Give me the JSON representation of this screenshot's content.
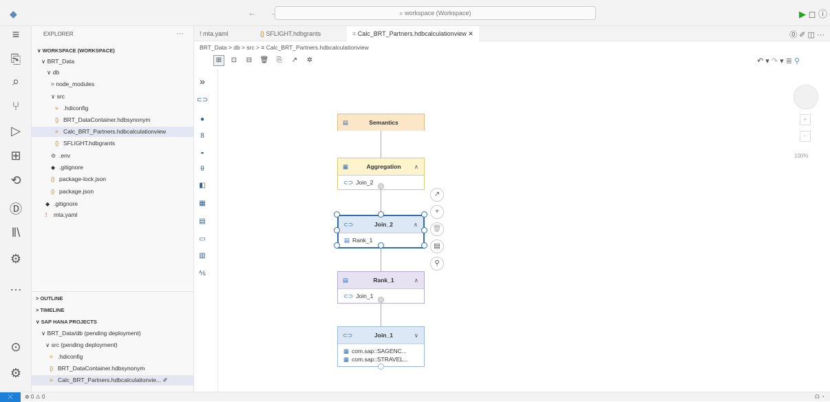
{
  "titlebar": {
    "search_placeholder": "workspace (Workspace)",
    "nav": "← →"
  },
  "explorer": {
    "header": "EXPLORER",
    "workspace": "WORKSPACE (WORKSPACE)",
    "items": [
      {
        "label": "BRT_Data",
        "chev": "∨"
      },
      {
        "label": "db",
        "chev": "∨"
      },
      {
        "label": "node_modules",
        "chev": ">"
      },
      {
        "label": "src",
        "chev": "∨"
      },
      {
        "label": ".hdiconfig",
        "icon": "≡"
      },
      {
        "label": "BRT_DataContainer.hdbsynonym",
        "icon": "{}"
      },
      {
        "label": "Calc_BRT_Partners.hdbcalculationview",
        "icon": "≡"
      },
      {
        "label": "SFLIGHT.hdbgrants",
        "icon": "{}"
      },
      {
        "label": ".env",
        "icon": "⚙"
      },
      {
        "label": ".gitignore",
        "icon": "◆"
      },
      {
        "label": "package-lock.json",
        "icon": "{}"
      },
      {
        "label": "package.json",
        "icon": "{}"
      },
      {
        "label": ".gitignore",
        "icon": "◆"
      },
      {
        "label": "mta.yaml",
        "icon": "!"
      }
    ],
    "outline": "OUTLINE",
    "timeline": "TIMELINE",
    "sap_hana": "SAP HANA PROJECTS",
    "hana_items": [
      {
        "label": "BRT_Data/db  (pending deployment)",
        "chev": "∨"
      },
      {
        "label": "src  (pending deployment)",
        "chev": "∨"
      },
      {
        "label": ".hdiconfig",
        "icon": "≡"
      },
      {
        "label": "BRT_DataContainer.hdbsynonym",
        "icon": "{}"
      },
      {
        "label": "Calc_BRT_Partners.hdbcalculationvie...",
        "icon": "≡"
      }
    ]
  },
  "tabs": [
    {
      "label": "mta.yaml",
      "icon": "!"
    },
    {
      "label": "SFLIGHT.hdbgrants",
      "icon": "{}"
    },
    {
      "label": "Calc_BRT_Partners.hdbcalculationview",
      "icon": "≡",
      "close": "✕"
    }
  ],
  "breadcrumb": "BRT_Data  >  db  >  src  >  ≡  Calc_BRT_Partners.hdbcalculationview",
  "zoom_level": "100%",
  "nodes": {
    "semantics": {
      "title": "Semantics"
    },
    "aggregation": {
      "title": "Aggregation",
      "input": "Join_2"
    },
    "join2": {
      "title": "Join_2",
      "input": "Rank_1"
    },
    "rank1": {
      "title": "Rank_1",
      "input": "Join_1"
    },
    "join1": {
      "title": "Join_1",
      "inputs": [
        "com.sap::SAGENC...",
        "com.sap::STRAVEL..."
      ]
    }
  },
  "status": {
    "problems": "⊗ 0 ⚠ 0"
  },
  "colors": {
    "semantics_header": "#fbe6c8",
    "aggregation_header": "#fdf3cc",
    "join_header": "#dde8f6",
    "rank_header": "#e6e2f2",
    "selected_border": "#2c6fb0"
  }
}
